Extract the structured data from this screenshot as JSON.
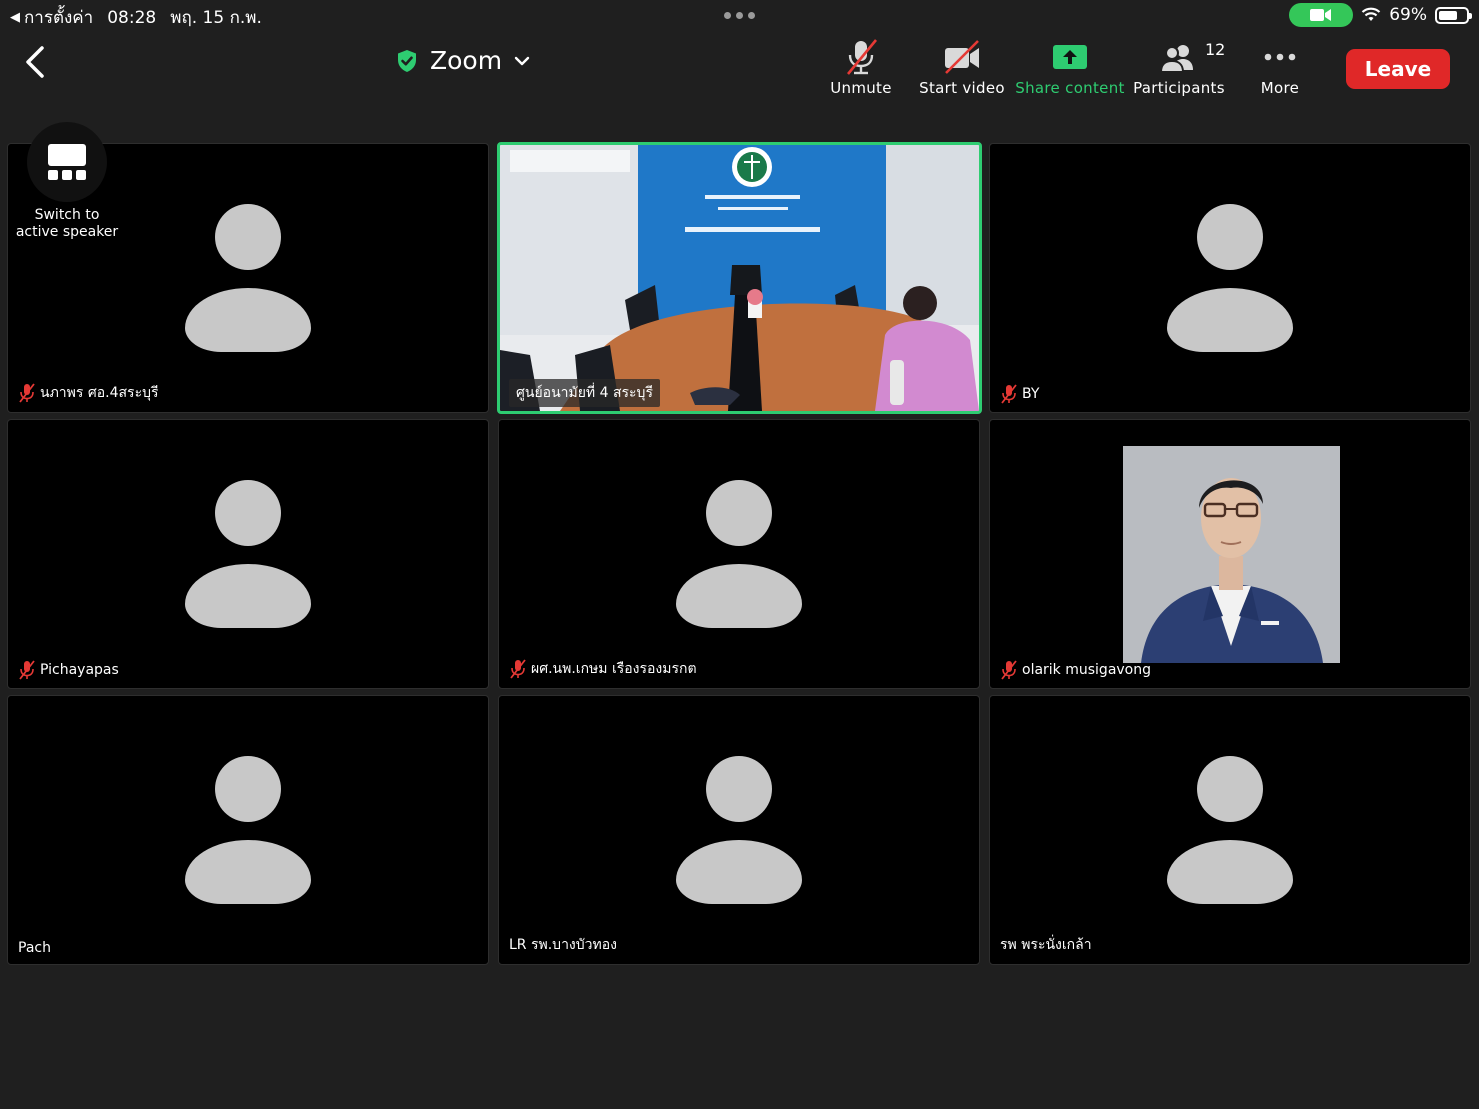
{
  "status_bar": {
    "back_app": "การตั้งค่า",
    "time": "08:28",
    "date": "พฤ. 15 ก.พ.",
    "battery": "69%",
    "battery_level": 0.69
  },
  "toolbar": {
    "title": "Zoom",
    "unmute": "Unmute",
    "start_video": "Start video",
    "share_content": "Share content",
    "participants": "Participants",
    "participant_count": "12",
    "more": "More",
    "leave": "Leave"
  },
  "switch_speaker": {
    "line1": "Switch to",
    "line2": "active speaker"
  },
  "tiles": [
    {
      "name": "นภาพร ศอ.4สระบุรี",
      "muted": true
    },
    {
      "name": "ศูนย์อนามัยที่ 4 สระบุรี",
      "muted": false
    },
    {
      "name": "BY",
      "muted": true
    },
    {
      "name": "Pichayapas",
      "muted": true
    },
    {
      "name": "ผศ.นพ.เกษม เรืองรองมรกต",
      "muted": true
    },
    {
      "name": "olarik musigavong",
      "muted": true
    },
    {
      "name": "Pach",
      "muted": false
    },
    {
      "name": "LR รพ.บางบัวทอง",
      "muted": false
    },
    {
      "name": "รพ พระนั่งเกล้า",
      "muted": false
    }
  ],
  "colors": {
    "background": "#1f1f1f",
    "active_border": "#2ecc71",
    "leave": "#e02828",
    "muted_icon": "#e53935",
    "share_icon": "#2ecc71"
  }
}
